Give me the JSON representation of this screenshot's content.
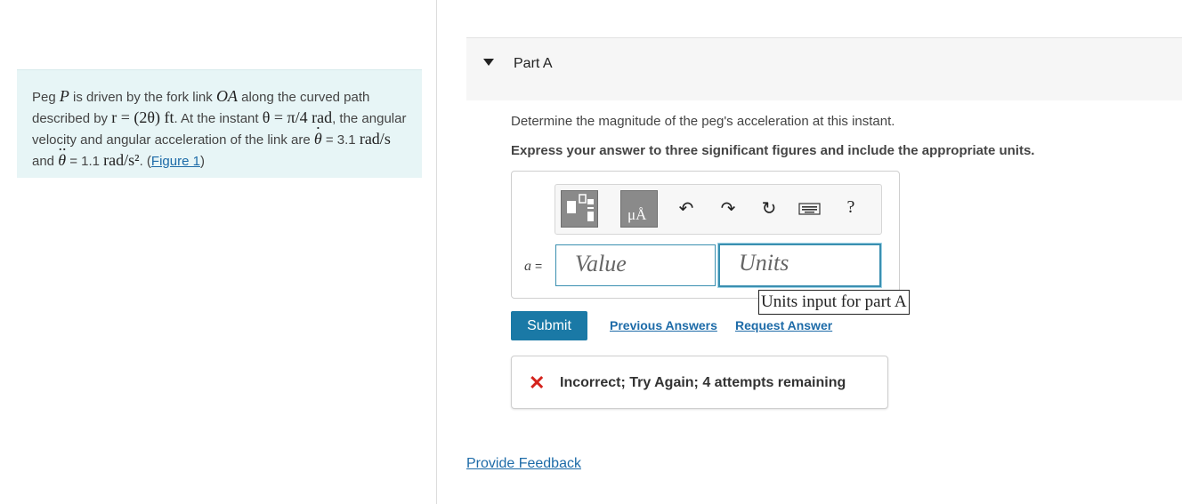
{
  "problem": {
    "t1": "Peg ",
    "P": "P",
    "t2": " is driven by the fork link ",
    "OA": "OA",
    "t3": " along the curved path described by ",
    "r_eq": "r = (2θ) ft",
    "t4": ". At the instant ",
    "theta_eq": "θ = π/4 rad",
    "t5": ", the angular velocity and angular acceleration of the link are ",
    "theta_dot_sym": "θ",
    "omega_val": " = 3.1 ",
    "omega_unit": "rad/s",
    "t6": " and ",
    "theta_ddot_sym": "θ",
    "alpha_val": " = 1.1 ",
    "alpha_unit": "rad/s²",
    "t7": ". (",
    "figure_link": "Figure 1",
    "t8": ")"
  },
  "part": {
    "title": "Part A",
    "question": "Determine the magnitude of the peg's acceleration at this instant.",
    "instructions": "Express your answer to three significant figures and include the appropriate units."
  },
  "toolbar": {
    "units_btn": "μÅ",
    "help": "?"
  },
  "answer": {
    "variable": "a",
    "equals": "=",
    "value_placeholder": "Value",
    "units_placeholder": "Units",
    "units_tooltip": "Units input for part A"
  },
  "actions": {
    "submit": "Submit",
    "previous_answers": "Previous Answers",
    "request_answer": "Request Answer"
  },
  "feedback": {
    "message": "Incorrect; Try Again; 4 attempts remaining",
    "color": "#d4231c"
  },
  "footer": {
    "provide_feedback": "Provide Feedback"
  }
}
